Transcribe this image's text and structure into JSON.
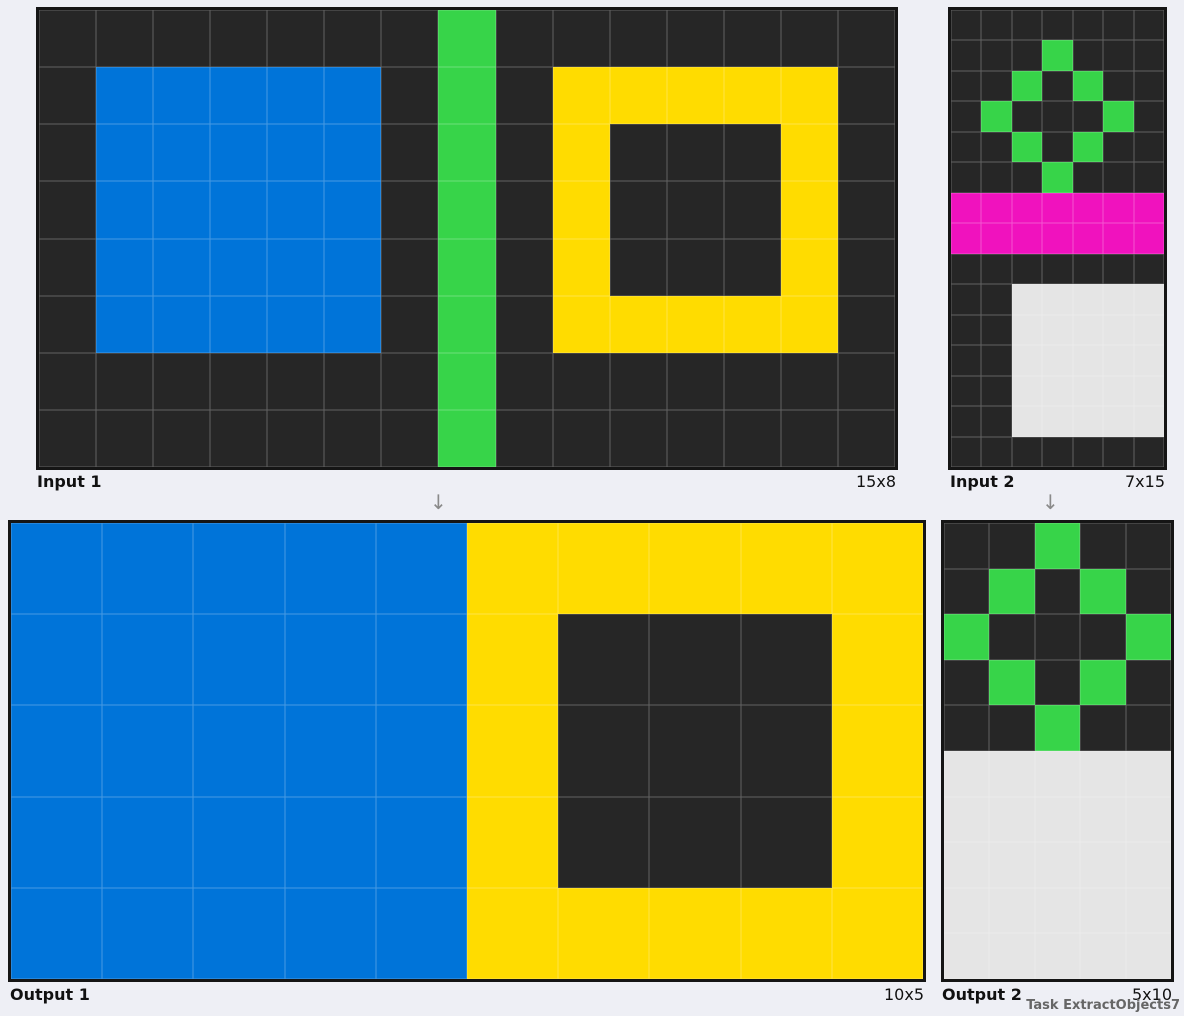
{
  "palette": {
    "0": "#262626",
    "1": "#0074d9",
    "2": "#37d449",
    "3": "#ffdc00",
    "4": "#f012be",
    "5": "#e5e5e5"
  },
  "pairs": [
    {
      "input": {
        "label": "Input 1",
        "dims": "15x8",
        "grid": [
          "000000020000000",
          "011111020333330",
          "011111020300030",
          "011111020300030",
          "011111020300030",
          "011111020333330",
          "000000020000000",
          "000000020000000"
        ]
      },
      "output": {
        "label": "Output 1",
        "dims": "10x5",
        "grid": [
          "1111133333",
          "1111130003",
          "1111130003",
          "1111130003",
          "1111133333"
        ]
      }
    },
    {
      "input": {
        "label": "Input 2",
        "dims": "7x15",
        "grid": [
          "0000000",
          "0002000",
          "0020200",
          "0200020",
          "0020200",
          "0002000",
          "4444444",
          "4444444",
          "0000000",
          "0055555",
          "0055555",
          "0055555",
          "0055555",
          "0055555",
          "0000000"
        ]
      },
      "output": {
        "label": "Output 2",
        "dims": "5x10",
        "grid": [
          "00200",
          "02020",
          "20002",
          "02020",
          "00200",
          "55555",
          "55555",
          "55555",
          "55555",
          "55555"
        ]
      }
    }
  ],
  "arrow_glyph": "↓",
  "task_name": "Task ExtractObjects7"
}
